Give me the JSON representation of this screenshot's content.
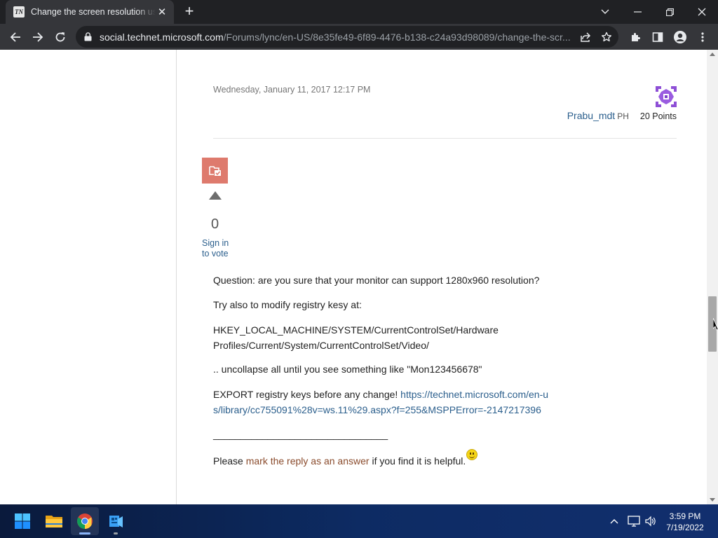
{
  "browser": {
    "tab": {
      "favicon_text": "TN",
      "title": "Change the screen resolution using"
    },
    "address": {
      "host": "social.technet.microsoft.com",
      "path": "/Forums/lync/en-US/8e35fe49-6f89-4476-b138-c24a93d98089/change-the-scr..."
    }
  },
  "post": {
    "date": "Wednesday, January 11, 2017 12:17 PM",
    "author": {
      "name": "Prabu_mdt",
      "flag": "PH",
      "points": "20 Points"
    }
  },
  "reply": {
    "vote_count": "0",
    "sign_in_line1": "Sign in",
    "sign_in_line2": "to vote",
    "paragraphs": {
      "p1": "Question: are you sure that your monitor can support 1280x960 resolution?",
      "p2": "Try also to modify registry kesy at:",
      "p3": "HKEY_LOCAL_MACHINE/SYSTEM/CurrentControlSet/Hardware Profiles/Current/System/CurrentControlSet/Video/",
      "p4": ".. uncollapse all until you see something like \"Mon123456678\"",
      "p5_prefix": "EXPORT registry keys before any change! ",
      "p5_link": "https://technet.microsoft.com/en-us/library/cc755091%28v=ws.11%29.aspx?f=255&MSPPError=-2147217396",
      "p6": "________________________________",
      "p7_prefix": "Please ",
      "p7_link": "mark the reply as an answer",
      "p7_suffix": " if you find it is helpful."
    }
  },
  "taskbar": {
    "apps": [
      "start-icon",
      "file-explorer-icon",
      "chrome-icon",
      "app-icon"
    ],
    "clock_time": "3:59 PM",
    "clock_date": "7/19/2022"
  },
  "colors": {
    "link": "#2a5e8c",
    "answer_link": "#8a4b2c",
    "proposed_badge": "#de7a6d"
  }
}
